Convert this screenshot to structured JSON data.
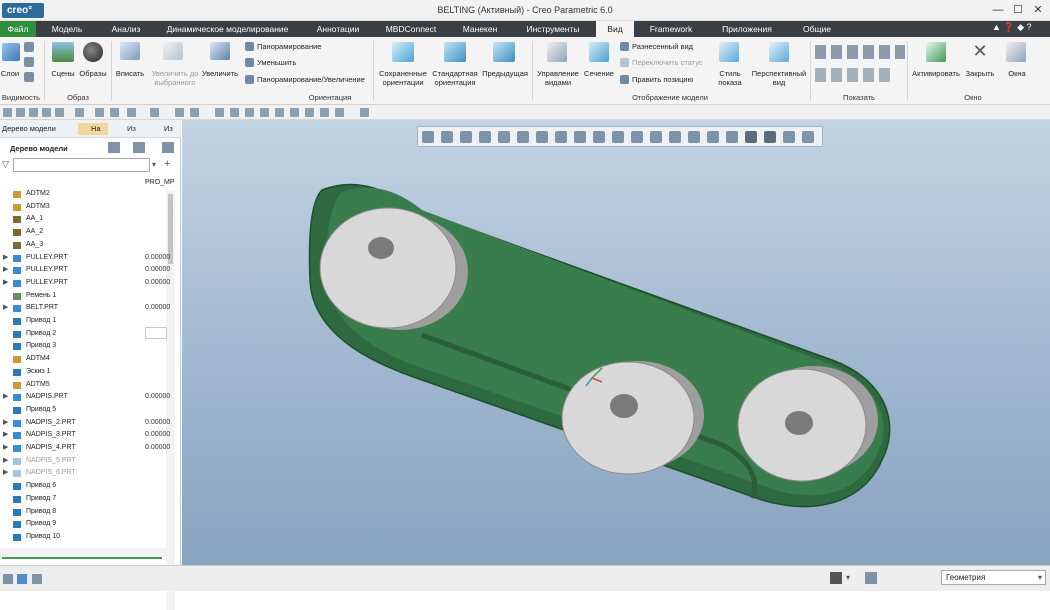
{
  "titlebar": {
    "logo": "creo°",
    "title": "BELTING (Активный) - Creo Parametric 6.0",
    "min": "—",
    "max": "☐",
    "close": "✕"
  },
  "menu": {
    "items": [
      "Файл",
      "Модель",
      "Анализ",
      "Динамическое моделирование",
      "Аннотации",
      "MBDConnect",
      "Манекен",
      "Инструменты",
      "Вид",
      "Framework",
      "Приложения",
      "Общие"
    ],
    "active": "Вид",
    "right_icons": "▲  ❓  ◆  ?"
  },
  "ribbon": {
    "visibility": {
      "layers": "Слои",
      "group": "Видимость"
    },
    "image": {
      "scenes": "Сцены",
      "images": "Образы",
      "group": "Образ"
    },
    "orientation": {
      "fit": "Вписать",
      "zoom_selected": "Увеличить до выбранного",
      "zoom_in": "Увеличить",
      "pan": "Панорамирование",
      "zoom_out": "Уменьшить",
      "pan_zoom": "Панорамирование/Увеличение",
      "saved": "Сохраненные ориентации",
      "standard": "Стандартная ориентация",
      "previous": "Предыдущая",
      "group": "Ориентация"
    },
    "model_display": {
      "manage_views": "Управление видами",
      "section": "Сечение",
      "exploded": "Разнесенный вид",
      "toggle_status": "Переключить статус",
      "edit_position": "Править позицию",
      "display_style": "Стиль показа",
      "perspective": "Перспективный вид",
      "group": "Отображение модели"
    },
    "show": {
      "group": "Показать"
    },
    "window": {
      "activate": "Активировать",
      "close": "Закрыть",
      "windows": "Окна",
      "group": "Окно"
    }
  },
  "leftpanel": {
    "tabs": [
      "Дерево модели",
      "На",
      "Из",
      "Из"
    ],
    "header": "Дерево модели",
    "search_placeholder": "",
    "column": "PRO_MP",
    "items": [
      {
        "label": "ADTM2",
        "value": "",
        "arrow": "",
        "type": "datum"
      },
      {
        "label": "ADTM3",
        "value": "",
        "arrow": "",
        "type": "datum"
      },
      {
        "label": "AA_1",
        "value": "",
        "arrow": "",
        "type": "axis"
      },
      {
        "label": "AA_2",
        "value": "",
        "arrow": "",
        "type": "axis"
      },
      {
        "label": "AA_3",
        "value": "",
        "arrow": "",
        "type": "axis"
      },
      {
        "label": "PULLEY.PRT",
        "value": "0.00000",
        "arrow": "▶",
        "type": "part"
      },
      {
        "label": "PULLEY.PRT",
        "value": "0.00000",
        "arrow": "▶",
        "type": "part"
      },
      {
        "label": "PULLEY.PRT",
        "value": "0.00000",
        "arrow": "▶",
        "type": "part"
      },
      {
        "label": "Ремень 1",
        "value": "",
        "arrow": "",
        "type": "belt"
      },
      {
        "label": "BELT.PRT",
        "value": "0.00000",
        "arrow": "▶",
        "type": "part"
      },
      {
        "label": "Привод 1",
        "value": "",
        "arrow": "",
        "type": "drive"
      },
      {
        "label": "Привод 2",
        "value": "",
        "arrow": "",
        "type": "drive"
      },
      {
        "label": "Привод 3",
        "value": "",
        "arrow": "",
        "type": "drive"
      },
      {
        "label": "ADTM4",
        "value": "",
        "arrow": "",
        "type": "datum"
      },
      {
        "label": "Эскиз 1",
        "value": "",
        "arrow": "",
        "type": "sketch"
      },
      {
        "label": "ADTM5",
        "value": "",
        "arrow": "",
        "type": "datum"
      },
      {
        "label": "NADPIS.PRT",
        "value": "0.00000",
        "arrow": "▶",
        "type": "part"
      },
      {
        "label": "Привод 5",
        "value": "",
        "arrow": "",
        "type": "drive"
      },
      {
        "label": "NADPIS_2.PRT",
        "value": "0.00000",
        "arrow": "▶",
        "type": "part"
      },
      {
        "label": "NADPIS_3.PRT",
        "value": "0.00000",
        "arrow": "▶",
        "type": "part"
      },
      {
        "label": "NADPIS_4.PRT",
        "value": "0.00000",
        "arrow": "▶",
        "type": "part"
      },
      {
        "label": "NADPIS_5.PRT",
        "value": "",
        "arrow": "▶",
        "type": "part-dim"
      },
      {
        "label": "NADPIS_6.PRT",
        "value": "",
        "arrow": "▶",
        "type": "part-dim"
      },
      {
        "label": "Привод 6",
        "value": "",
        "arrow": "",
        "type": "drive"
      },
      {
        "label": "Привод 7",
        "value": "",
        "arrow": "",
        "type": "drive"
      },
      {
        "label": "Привод 8",
        "value": "",
        "arrow": "",
        "type": "drive"
      },
      {
        "label": "Привод 9",
        "value": "",
        "arrow": "",
        "type": "drive"
      },
      {
        "label": "Привод 10",
        "value": "",
        "arrow": "",
        "type": "drive"
      }
    ]
  },
  "statusbar": {
    "filter": "Геометрия"
  },
  "colors": {
    "menubar": "#3a3f44",
    "file_tab": "#2d8f3a",
    "belt": "#2e6a3f",
    "pulley": "#d6d6d6",
    "viewport_top": "#c3d4e4",
    "viewport_bottom": "#89a4c0"
  }
}
